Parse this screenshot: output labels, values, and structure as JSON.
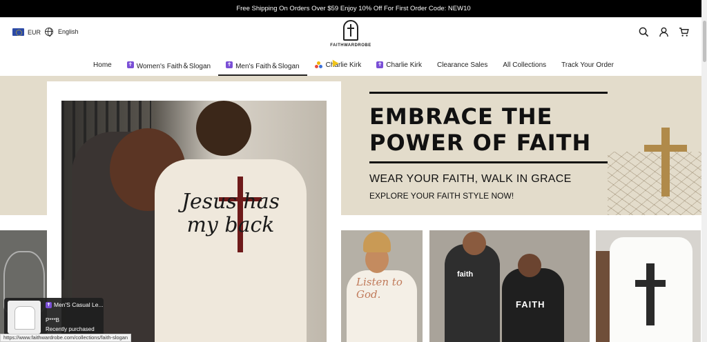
{
  "announcement": "Free Shipping On Orders Over $59 Enjoy 10% Off For First Order Code: NEW10",
  "header": {
    "currency": "EUR",
    "language": "English",
    "logo_text": "FAITHWARDROBE",
    "icons": [
      "search-icon",
      "account-icon",
      "cart-icon"
    ]
  },
  "nav": {
    "items": [
      {
        "label": "Home",
        "badge": ""
      },
      {
        "label": "Women's Faith＆Slogan",
        "badge": "✝"
      },
      {
        "label": "Men's Faith＆Slogan",
        "badge": "✝",
        "active": true
      },
      {
        "label": "Charlie Kirk",
        "badge": "tri"
      },
      {
        "label": "Charlie Kirk",
        "badge": "✝"
      },
      {
        "label": "Clearance Sales",
        "badge": ""
      },
      {
        "label": "All Collections",
        "badge": ""
      },
      {
        "label": "Track Your Order",
        "badge": ""
      }
    ]
  },
  "hero": {
    "title_line1": "EMBRACE THE",
    "title_line2": "POWER OF FAITH",
    "subtitle": "WEAR YOUR FAITH, WALK IN GRACE",
    "cta": "EXPLORE YOUR FAITH STYLE NOW!",
    "shirt_text": "Jesus has my back"
  },
  "tiles": {
    "tile3_text": "Listen to God.",
    "tile4_text1": "faith",
    "tile4_text2": "FAITH"
  },
  "popup": {
    "title": "Men'S Casual Le...",
    "user": "P***B",
    "status": "Recently purchased"
  },
  "status_url": "https://www.faithwardrobe.com/collections/faith-slogan",
  "colors": {
    "announcement_bg": "#000000",
    "hero_bg": "#e3dccb",
    "badge_purple": "#7a4fd6"
  }
}
